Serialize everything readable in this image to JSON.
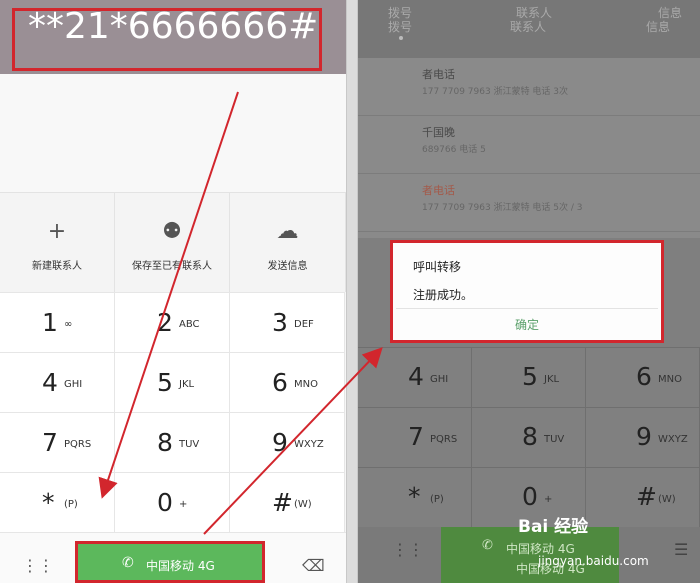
{
  "left": {
    "number": "**21*6666666#",
    "actions": [
      {
        "icon": "plus-icon",
        "glyph": "+",
        "label": "新建联系人"
      },
      {
        "icon": "person-icon",
        "glyph": "⚉",
        "label": "保存至已有联系人"
      },
      {
        "icon": "chat-bubble-icon",
        "glyph": "☁",
        "label": "发送信息"
      }
    ],
    "keys": [
      {
        "digit": "1",
        "letters": "∞"
      },
      {
        "digit": "2",
        "letters": "ABC"
      },
      {
        "digit": "3",
        "letters": "DEF"
      },
      {
        "digit": "4",
        "letters": "GHI"
      },
      {
        "digit": "5",
        "letters": "JKL"
      },
      {
        "digit": "6",
        "letters": "MNO"
      },
      {
        "digit": "7",
        "letters": "PQRS"
      },
      {
        "digit": "8",
        "letters": "TUV"
      },
      {
        "digit": "9",
        "letters": "WXYZ"
      },
      {
        "digit": "*",
        "letters": "(P)"
      },
      {
        "digit": "0",
        "letters": "+"
      },
      {
        "digit": "#",
        "letters": "(W)"
      }
    ],
    "call_label": "中国移动 4G",
    "highlight_color": "#d2262d",
    "call_color": "#5cb85c"
  },
  "right": {
    "tabs": [
      {
        "top": "拨号",
        "bottom": "拨号"
      },
      {
        "top": "联系人",
        "bottom": "联系人"
      },
      {
        "top": "信息",
        "bottom": "信息"
      }
    ],
    "calls": [
      {
        "name": "者电话",
        "sub": "177 7709 7963 浙江蒙特 电话 3次"
      },
      {
        "name": "千国晚",
        "sub": "689766 电话 5"
      },
      {
        "name": "者电话",
        "sub": "177 7709 7963 浙江蒙特 电话 5次 / 3"
      }
    ],
    "dialog": {
      "title": "呼叫转移",
      "message": "注册成功。",
      "ok": "确定"
    },
    "keys": [
      {
        "digit": "4",
        "letters": "GHI"
      },
      {
        "digit": "5",
        "letters": "JKL"
      },
      {
        "digit": "6",
        "letters": "MNO"
      },
      {
        "digit": "7",
        "letters": "PQRS"
      },
      {
        "digit": "8",
        "letters": "TUV"
      },
      {
        "digit": "9",
        "letters": "WXYZ"
      },
      {
        "digit": "*",
        "letters": "(P)"
      },
      {
        "digit": "0",
        "letters": "+"
      },
      {
        "digit": "#",
        "letters": "(W)"
      }
    ],
    "call_label": "中国移动 4G",
    "call_label_2": "中国移动 4G"
  },
  "watermark": {
    "brand": "Bai 经验",
    "url": "jingyan.baidu.com"
  }
}
